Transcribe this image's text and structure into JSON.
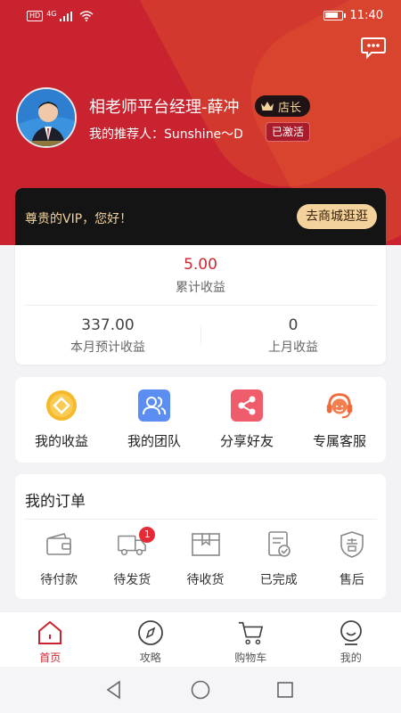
{
  "status_bar": {
    "network": "HD",
    "signal": "4G",
    "time": "11:40",
    "battery_level": 0.8
  },
  "header": {
    "message_icon": "chat-bubble-icon",
    "profile": {
      "name": "相老师平台经理-薛冲",
      "role_badge": "店长",
      "referrer_label": "我的推荐人：Sunshine～D",
      "referrer_status": "已激活"
    }
  },
  "vip_card": {
    "greeting": "尊贵的VIP，您好！",
    "shop_button": "去商城逛逛",
    "total_value": "5.00",
    "total_label": "累计收益",
    "this_month_value": "337.00",
    "this_month_label": "本月预计收益",
    "last_month_value": "0",
    "last_month_label": "上月收益"
  },
  "quick_actions": [
    {
      "label": "我的收益",
      "icon": "earnings-icon",
      "color": "#f6b92b"
    },
    {
      "label": "我的团队",
      "icon": "team-icon",
      "color": "#5b8ef0"
    },
    {
      "label": "分享好友",
      "icon": "share-icon",
      "color": "#ef5d6c"
    },
    {
      "label": "专属客服",
      "icon": "customer-service-icon",
      "color": "#f06b3c"
    }
  ],
  "orders": {
    "title": "我的订单",
    "items": [
      {
        "label": "待付款",
        "icon": "wallet-icon"
      },
      {
        "label": "待发货",
        "icon": "truck-icon",
        "badge": "1"
      },
      {
        "label": "待收货",
        "icon": "package-icon"
      },
      {
        "label": "已完成",
        "icon": "completed-icon"
      },
      {
        "label": "售后",
        "icon": "after-sale-icon"
      }
    ]
  },
  "tab_bar": [
    {
      "label": "首页",
      "icon": "home-icon",
      "active": true
    },
    {
      "label": "攻略",
      "icon": "compass-icon",
      "active": false
    },
    {
      "label": "购物车",
      "icon": "cart-icon",
      "active": false
    },
    {
      "label": "我的",
      "icon": "profile-icon",
      "active": false
    }
  ],
  "colors": {
    "brand_red": "#c8232f",
    "gold": "#f3d29c",
    "dark": "#141414"
  }
}
